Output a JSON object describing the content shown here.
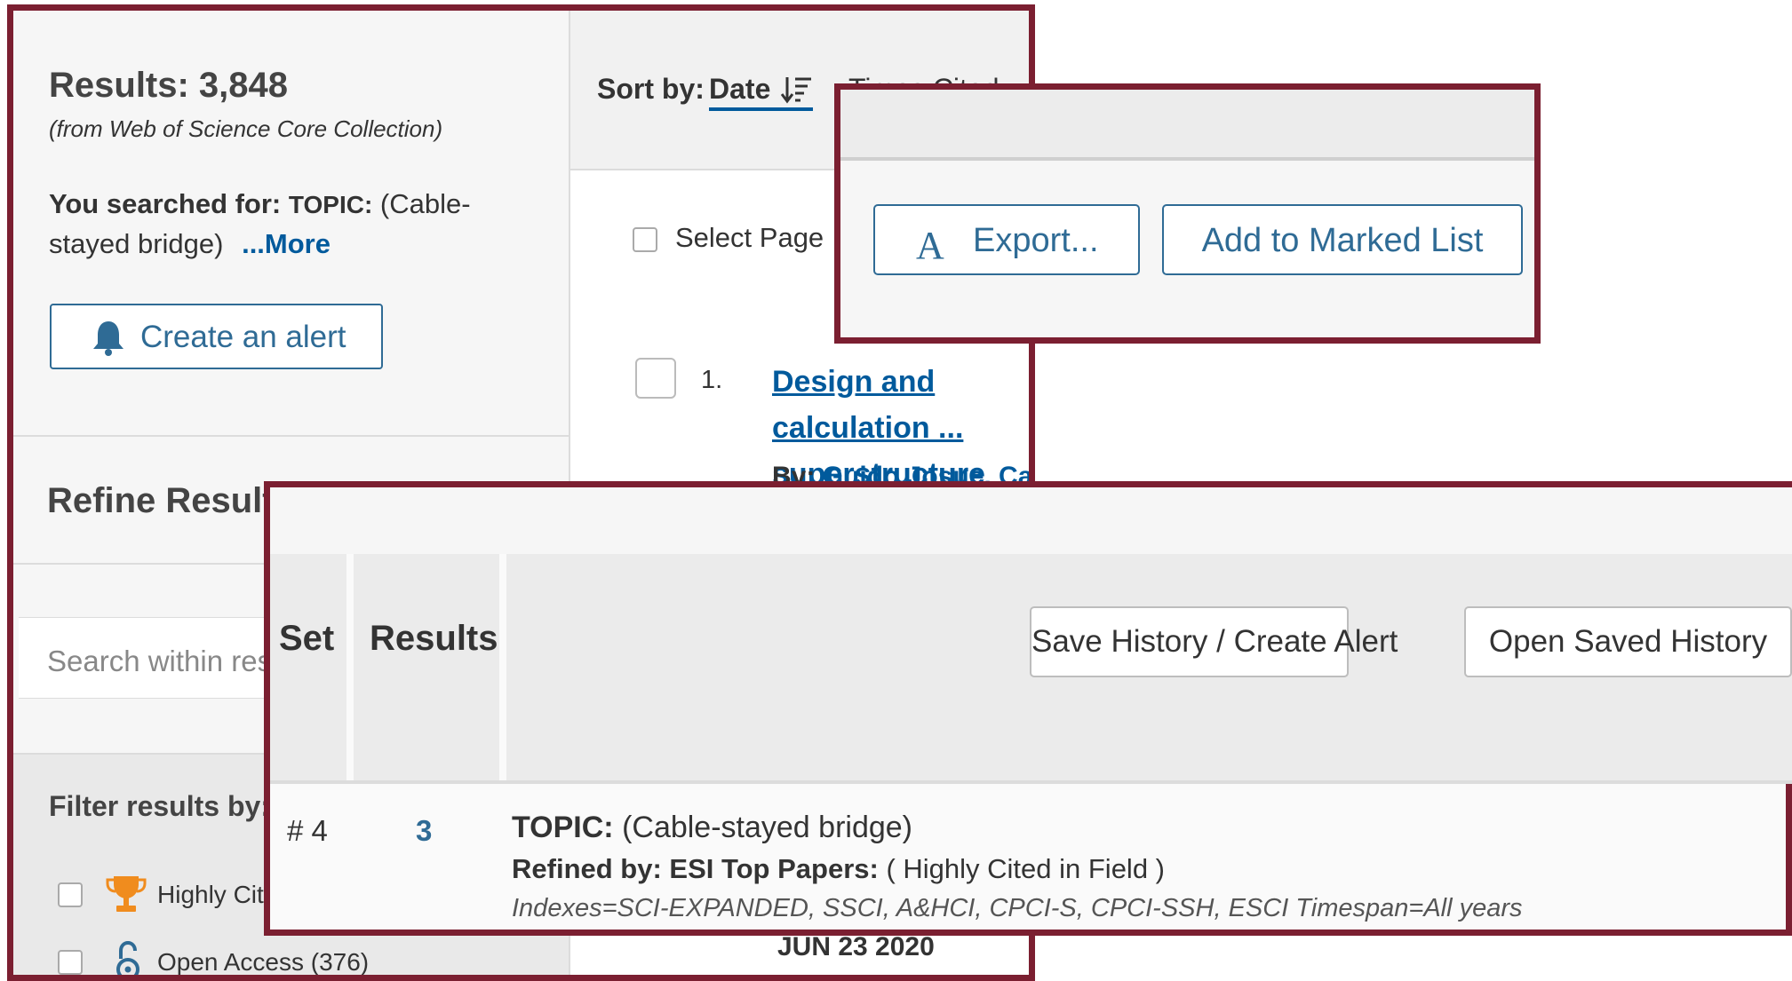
{
  "colors": {
    "frame": "#7b1f31",
    "accent": "#2f6b95",
    "link": "#005a9c",
    "trophy": "#f08c1e"
  },
  "summary": {
    "results_label": "Results: 3,848",
    "source": "(from Web of Science Core Collection)",
    "searched_label": "You searched for:",
    "searched_field": "TOPIC:",
    "searched_query": "(Cable-stayed bridge)",
    "more_link": "...More",
    "create_alert_label": "Create an alert",
    "create_alert_icon": "bell-icon"
  },
  "refine": {
    "title": "Refine Results",
    "search_placeholder": "Search within results",
    "filter_label": "Filter results by:",
    "filters": [
      {
        "label": "Highly Cited",
        "icon": "trophy-icon"
      },
      {
        "label": "Open Access (376)",
        "icon": "open-access-icon"
      }
    ]
  },
  "sort": {
    "label": "Sort by:",
    "date_label": "Date",
    "date_icon": "sort-descending-icon",
    "times_cited_label": "Times Cited"
  },
  "records": {
    "select_page_label": "Select Page",
    "items": [
      {
        "number": "1.",
        "title": "Design and calculation ... superstructure",
        "by_label": "By:",
        "author": "Guido Josue, Cast",
        "date": "JUN 23 2020"
      }
    ]
  },
  "export": {
    "export_label": "Export...",
    "export_icon": "text-a-icon",
    "add_marked_label": "Add to Marked List"
  },
  "history": {
    "set_header": "Set",
    "results_header": "Results",
    "save_label": "Save History / Create Alert",
    "open_label": "Open Saved History",
    "rows": [
      {
        "set": "# 4",
        "count": "3",
        "topic_label": "TOPIC:",
        "topic_value": "(Cable-stayed bridge)",
        "refined_label": "Refined by: ESI Top Papers:",
        "refined_value": "( Highly Cited in Field )",
        "indexes": "Indexes=SCI-EXPANDED, SSCI, A&HCI, CPCI-S, CPCI-SSH, ESCI Timespan=All years"
      }
    ]
  }
}
